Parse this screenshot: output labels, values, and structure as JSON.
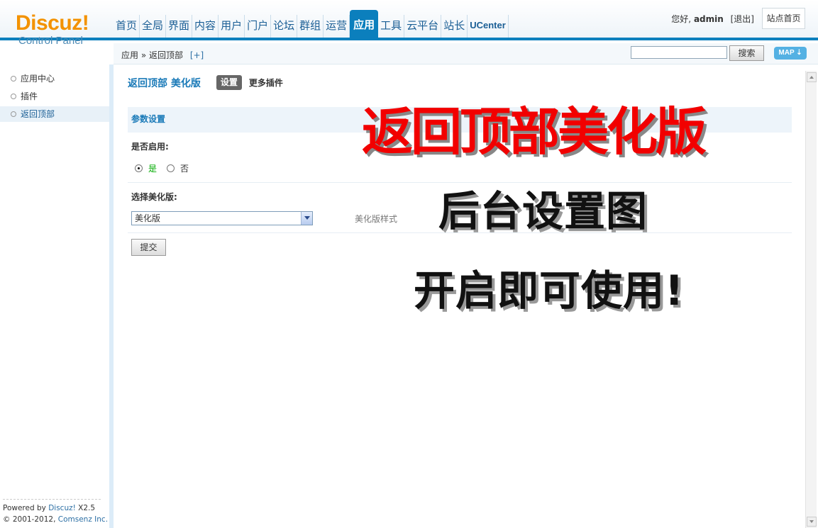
{
  "logo": {
    "main": "Discuz!",
    "sub": "Control Panel"
  },
  "nav": {
    "items": [
      "首页",
      "全局",
      "界面",
      "内容",
      "用户",
      "门户",
      "论坛",
      "群组",
      "运营",
      "应用",
      "工具",
      "云平台",
      "站长",
      "UCenter"
    ],
    "active": "应用"
  },
  "user": {
    "greeting": "您好,",
    "name": "admin",
    "logout": "[退出]",
    "site_home": "站点首页"
  },
  "subbar": {
    "breadcrumb": "应用 » 返回顶部",
    "plus": "[+]",
    "search_button": "搜索",
    "map_button": "MAP ⇣"
  },
  "sidebar": {
    "items": [
      {
        "label": "应用中心"
      },
      {
        "label": "插件"
      },
      {
        "label": "返回顶部"
      }
    ],
    "active_index": 2,
    "footer": {
      "powered_prefix": "Powered by ",
      "powered_brand": "Discuz!",
      "powered_version": " X2.5",
      "copyright_prefix": "© 2001-2012, ",
      "copyright_company": "Comsenz Inc."
    }
  },
  "main": {
    "title": "返回顶部 美化版",
    "tab_active": "设置",
    "tab_more": "更多插件",
    "section_title": "参数设置",
    "enable_label": "是否启用:",
    "radio_yes": "是",
    "radio_no": "否",
    "style_label": "选择美化版:",
    "select_value": "美化版",
    "select_hint": "美化版样式",
    "submit": "提交"
  },
  "overlay": {
    "line1": "返回顶部美化版",
    "line2": "后台设置图",
    "line3": "开启即可使用!"
  },
  "colors": {
    "brand": "#f39200",
    "accent": "#0b7fbd",
    "overlay_red": "#f20000"
  }
}
